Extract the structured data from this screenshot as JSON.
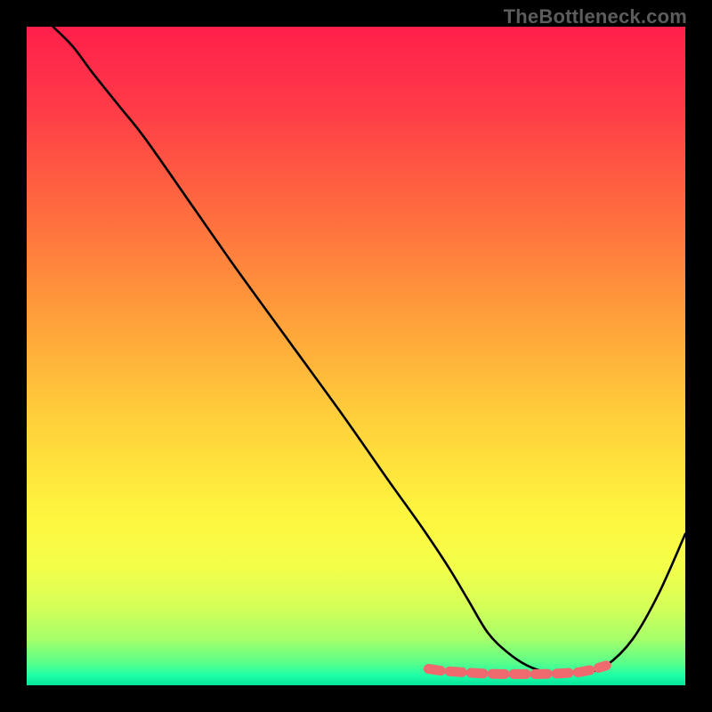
{
  "watermark": "TheBottleneck.com",
  "chart_data": {
    "type": "line",
    "title": "",
    "xlabel": "",
    "ylabel": "",
    "xlim": [
      0,
      100
    ],
    "ylim": [
      0,
      100
    ],
    "series": [
      {
        "name": "bottleneck-curve",
        "x": [
          4,
          7,
          10,
          14,
          18,
          25,
          32,
          40,
          48,
          55,
          60,
          64,
          67,
          70,
          73,
          76,
          79,
          82,
          85,
          88,
          92,
          96,
          100
        ],
        "y": [
          100,
          97,
          93,
          88,
          83,
          73,
          63,
          52,
          41,
          31,
          24,
          18,
          13,
          8,
          5,
          3,
          2,
          2,
          2,
          3,
          7,
          14,
          23
        ]
      }
    ],
    "markers": {
      "name": "highlight-band",
      "x": [
        61,
        63,
        66,
        69,
        72,
        75,
        78,
        81,
        84,
        86,
        88
      ],
      "y": [
        2.5,
        2.2,
        2.0,
        1.8,
        1.7,
        1.7,
        1.7,
        1.8,
        2.0,
        2.4,
        3.0
      ]
    },
    "gradient_stops": [
      {
        "offset": 0.0,
        "color": "#ff1f4b"
      },
      {
        "offset": 0.12,
        "color": "#ff3a48"
      },
      {
        "offset": 0.28,
        "color": "#ff6b3f"
      },
      {
        "offset": 0.45,
        "color": "#ffa23a"
      },
      {
        "offset": 0.6,
        "color": "#ffd13b"
      },
      {
        "offset": 0.74,
        "color": "#fff53e"
      },
      {
        "offset": 0.82,
        "color": "#f4ff4a"
      },
      {
        "offset": 0.88,
        "color": "#d6ff58"
      },
      {
        "offset": 0.93,
        "color": "#a6ff6a"
      },
      {
        "offset": 0.965,
        "color": "#5cff89"
      },
      {
        "offset": 0.985,
        "color": "#1dffa6"
      },
      {
        "offset": 1.0,
        "color": "#06e39a"
      }
    ]
  }
}
